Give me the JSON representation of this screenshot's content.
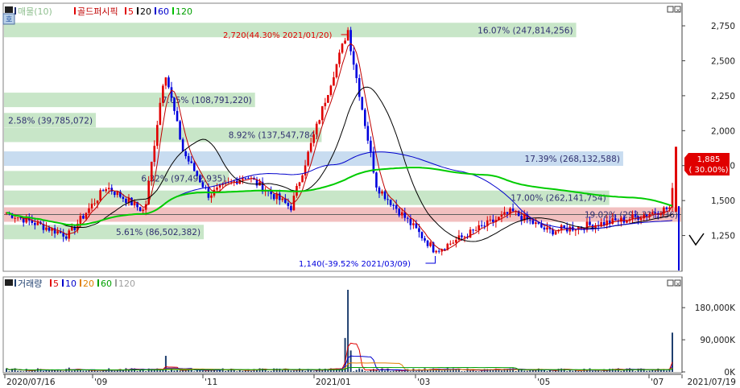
{
  "price_panel": {
    "legend": [
      {
        "label": "매물(10)",
        "color": "#8fbf8f",
        "marker": "#1f2f6f"
      },
      {
        "label": "골드퍼시픽",
        "color": "#c00000",
        "marker": "#e00000"
      },
      {
        "label": "5",
        "color": "#e00000",
        "marker": "#e00000"
      },
      {
        "label": "20",
        "color": "#000000",
        "marker": "#000000"
      },
      {
        "label": "60",
        "color": "#0000cc",
        "marker": "#0000cc"
      },
      {
        "label": "120",
        "color": "#00a000",
        "marker": "#00c000"
      }
    ],
    "current_price_label": "1,885",
    "current_change_label": "( 30.00%)",
    "high_annotation": "2,720(44.30% 2021/01/20)",
    "low_annotation": "1,140(-39.52% 2021/03/09)"
  },
  "volume_panel": {
    "legend": [
      {
        "label": "거래량",
        "color": "#1f3f6f",
        "marker": "#1f3f6f"
      },
      {
        "label": "5",
        "color": "#e00000",
        "marker": "#e00000"
      },
      {
        "label": "10",
        "color": "#0000cc",
        "marker": "#0000cc"
      },
      {
        "label": "20",
        "color": "#e08000",
        "marker": "#e08000"
      },
      {
        "label": "60",
        "color": "#00a000",
        "marker": "#00a000"
      },
      {
        "label": "120",
        "color": "#a0a0a0",
        "marker": "#a0a0a0"
      }
    ]
  },
  "colors": {
    "up": "#e00000",
    "down": "#0000dd",
    "ma5": "#c00000",
    "ma20": "#000000",
    "ma60": "#0000cc",
    "ma120": "#00cc00",
    "band": "#c8e6c8",
    "band_highlight": "#c8dcf0",
    "band_current": "#f2c0c0"
  },
  "chart_data": [
    {
      "type": "candlestick",
      "title": "골드퍼시픽",
      "ylim": [
        1000,
        2900
      ],
      "y_ticks": [
        1250,
        1500,
        1750,
        2000,
        2250,
        2500,
        2750
      ],
      "y_tick_labels": [
        "1,250",
        "1,500",
        "1,750",
        "2,000",
        "2,250",
        "2,500",
        "2,750"
      ],
      "date_range": [
        "2020/07/16",
        "2021/07/19"
      ],
      "x_tick_labels": [
        "2020/07/16",
        "'09",
        "'11",
        "2021/01",
        "'03",
        "'05",
        "'07",
        "2021/07/19"
      ],
      "key_points": [
        {
          "date": "2020/07/16",
          "price": 1420
        },
        {
          "date": "2020/08/20",
          "price": 1250
        },
        {
          "date": "2020/09/10",
          "price": 1600
        },
        {
          "date": "2020/10/01",
          "price": 1420
        },
        {
          "date": "2020/10/12",
          "price": 2440
        },
        {
          "date": "2020/10/22",
          "price": 1850
        },
        {
          "date": "2020/11/05",
          "price": 1540
        },
        {
          "date": "2020/11/25",
          "price": 1680
        },
        {
          "date": "2020/12/20",
          "price": 1450
        },
        {
          "date": "2021/01/20",
          "price": 2720
        },
        {
          "date": "2021/02/05",
          "price": 1600
        },
        {
          "date": "2021/03/09",
          "price": 1140
        },
        {
          "date": "2021/04/20",
          "price": 1420
        },
        {
          "date": "2021/05/10",
          "price": 1280
        },
        {
          "date": "2021/06/20",
          "price": 1360
        },
        {
          "date": "2021/07/16",
          "price": 1450
        },
        {
          "date": "2021/07/19",
          "price": 1885
        }
      ],
      "volume_by_price": [
        {
          "price": 2720,
          "label": "16.07% (247,814,256)",
          "percent": 16.07
        },
        {
          "price": 2220,
          "label": "7.05% (108,791,220)",
          "percent": 7.05
        },
        {
          "price": 2075,
          "label": "2.58% (39,785,072)",
          "percent": 2.58
        },
        {
          "price": 1970,
          "label": "8.92% (137,547,784)",
          "percent": 8.92
        },
        {
          "price": 1800,
          "label": "17.39% (268,132,588)",
          "percent": 17.39
        },
        {
          "price": 1660,
          "label": "6.32% (97,492,935)",
          "percent": 6.32
        },
        {
          "price": 1520,
          "label": "17.00% (262,141,754)",
          "percent": 17.0
        },
        {
          "price": 1400,
          "label": "19.02% (293,3??,336)",
          "percent": 19.02
        },
        {
          "price": 1275,
          "label": "5.61% (86,502,382)",
          "percent": 5.61
        }
      ],
      "high": {
        "price": 2720,
        "change": "44.30%",
        "date": "2021/01/20"
      },
      "low": {
        "price": 1140,
        "change": "-39.52%",
        "date": "2021/03/09"
      },
      "last": {
        "price": 1885,
        "change": "30.00%"
      }
    },
    {
      "type": "bar",
      "title": "거래량",
      "ylim": [
        0,
        230000
      ],
      "y_ticks": [
        0,
        90000,
        180000
      ],
      "y_tick_labels": [
        "0K",
        "90,000K",
        "180,000K"
      ],
      "spikes": [
        {
          "date": "2020/08/20",
          "volume": 12000
        },
        {
          "date": "2020/10/12",
          "volume": 45000
        },
        {
          "date": "2021/01/19",
          "volume": 95000
        },
        {
          "date": "2021/01/20",
          "volume": 230000
        },
        {
          "date": "2021/01/22",
          "volume": 60000
        },
        {
          "date": "2021/07/19",
          "volume": 110000
        }
      ]
    }
  ]
}
